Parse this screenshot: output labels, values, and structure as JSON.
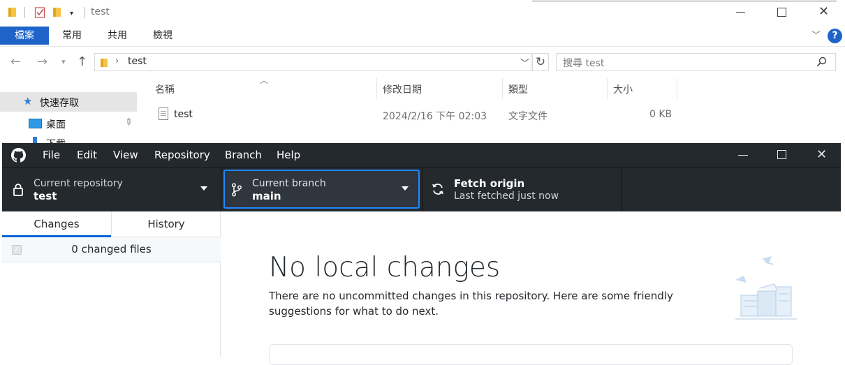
{
  "explorer": {
    "title": "test",
    "ribbon_tabs": [
      {
        "label": "檔案"
      },
      {
        "label": "常用"
      },
      {
        "label": "共用"
      },
      {
        "label": "檢視"
      }
    ],
    "address": {
      "path": "test"
    },
    "search": {
      "placeholder": "搜尋 test"
    },
    "columns": [
      {
        "label": "名稱"
      },
      {
        "label": "修改日期"
      },
      {
        "label": "類型"
      },
      {
        "label": "大小"
      }
    ],
    "nav": [
      {
        "label": "快速存取"
      },
      {
        "label": "桌面"
      },
      {
        "label": "下載"
      }
    ],
    "file": {
      "name": "test",
      "modified": "2024/2/16 下午 02:03",
      "type": "文字文件",
      "size": "0 KB"
    },
    "help_label": "?"
  },
  "ghd": {
    "menu": [
      {
        "label": "File"
      },
      {
        "label": "Edit"
      },
      {
        "label": "View"
      },
      {
        "label": "Repository"
      },
      {
        "label": "Branch"
      },
      {
        "label": "Help"
      }
    ],
    "toolbar": {
      "repo_label": "Current repository",
      "repo_value": "test",
      "branch_label": "Current branch",
      "branch_value": "main",
      "fetch_title": "Fetch origin",
      "fetch_sub": "Last fetched just now"
    },
    "tabs": [
      {
        "label": "Changes"
      },
      {
        "label": "History"
      }
    ],
    "changed_files": "0 changed files",
    "main": {
      "heading": "No local changes",
      "description": "There are no uncommitted changes in this repository. Here are some friendly suggestions for what to do next."
    }
  },
  "colors": {
    "ribbon_accent": "#1e64c8",
    "ghd_dark": "#24292e",
    "ghd_blue": "#0366d6",
    "help_blue": "#1e64c8"
  }
}
